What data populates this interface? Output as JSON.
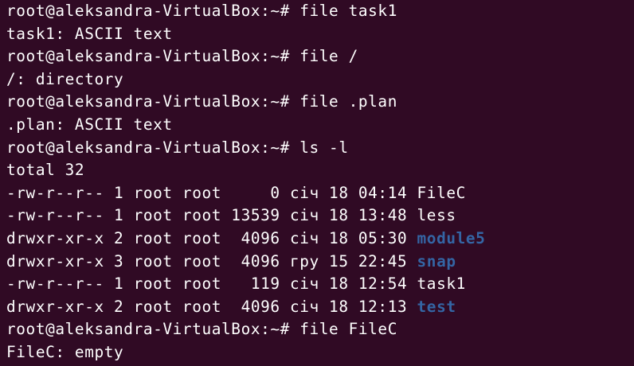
{
  "terminal": {
    "colors": {
      "background": "#300a24",
      "text": "#ffffff",
      "directory": "#3465a4"
    },
    "lines": [
      {
        "text": "root@aleksandra-VirtualBox:~# file task1"
      },
      {
        "text": "task1: ASCII text"
      },
      {
        "text": "root@aleksandra-VirtualBox:~# file /"
      },
      {
        "text": "/: directory"
      },
      {
        "text": "root@aleksandra-VirtualBox:~# file .plan"
      },
      {
        "text": ".plan: ASCII text"
      },
      {
        "text": "root@aleksandra-VirtualBox:~# ls -l"
      },
      {
        "text": "total 32"
      },
      {
        "prefix": "-rw-r--r-- 1 root root     0 січ 18 04:14 ",
        "name": "FileC",
        "is_dir": false
      },
      {
        "prefix": "-rw-r--r-- 1 root root 13539 січ 18 13:48 ",
        "name": "less",
        "is_dir": false
      },
      {
        "prefix": "drwxr-xr-x 2 root root  4096 січ 18 05:30 ",
        "name": "module5",
        "is_dir": true
      },
      {
        "prefix": "drwxr-xr-x 3 root root  4096 гру 15 22:45 ",
        "name": "snap",
        "is_dir": true
      },
      {
        "prefix": "-rw-r--r-- 1 root root   119 січ 18 12:54 ",
        "name": "task1",
        "is_dir": false
      },
      {
        "prefix": "drwxr-xr-x 2 root root  4096 січ 18 12:13 ",
        "name": "test",
        "is_dir": true
      },
      {
        "text": "root@aleksandra-VirtualBox:~# file FileC"
      },
      {
        "text": "FileC: empty"
      }
    ]
  }
}
